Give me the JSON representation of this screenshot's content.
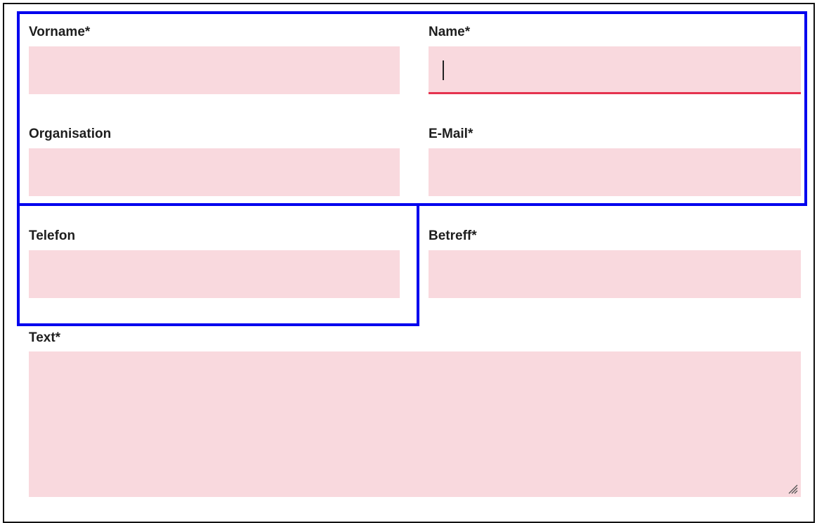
{
  "form": {
    "fields": {
      "vorname": {
        "label": "Vorname",
        "required_mark": "*",
        "value": ""
      },
      "name": {
        "label": "Name",
        "required_mark": "*",
        "value": "",
        "focused": true
      },
      "organisation": {
        "label": "Organisation",
        "value": ""
      },
      "email": {
        "label": "E-Mail",
        "required_mark": "*",
        "value": ""
      },
      "telefon": {
        "label": "Telefon",
        "value": ""
      },
      "betreff": {
        "label": "Betreff",
        "required_mark": "*",
        "value": ""
      },
      "text": {
        "label": "Text",
        "required_mark": "*",
        "value": ""
      }
    }
  },
  "colors": {
    "input_background": "#f9d9de",
    "focus_underline": "#e5334f",
    "highlight_outline": "#0000ee"
  },
  "icons": {
    "textarea_resize": "resize-grip-icon"
  }
}
